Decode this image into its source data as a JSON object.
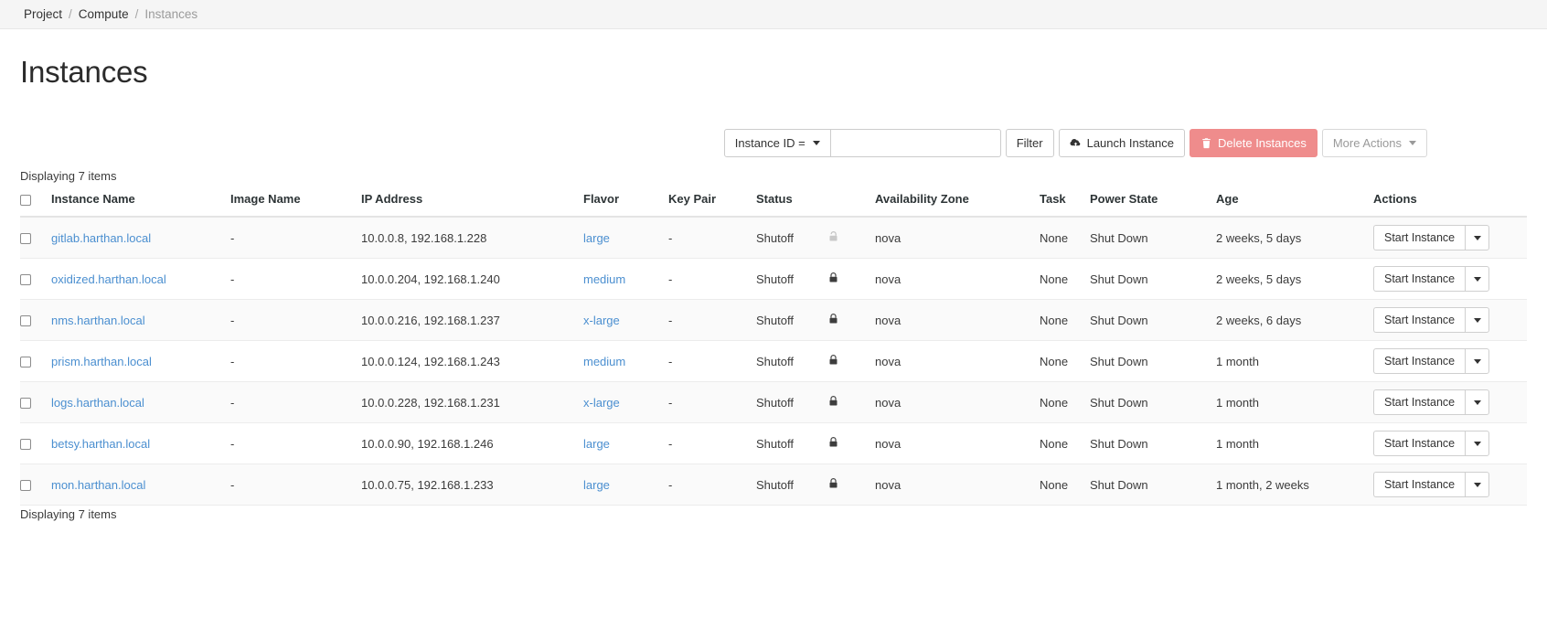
{
  "breadcrumb": {
    "items": [
      {
        "label": "Project",
        "link": true
      },
      {
        "label": "Compute",
        "link": true
      },
      {
        "label": "Instances",
        "link": false
      }
    ],
    "separator": "/"
  },
  "page": {
    "title": "Instances"
  },
  "toolbar": {
    "filter_field_label": "Instance ID =",
    "filter_field_icon": "chevron-down-icon",
    "search_value": "",
    "search_placeholder": "",
    "filter_button": "Filter",
    "launch_button": "Launch Instance",
    "launch_icon": "cloud-upload-icon",
    "delete_button": "Delete Instances",
    "delete_icon": "trash-icon",
    "delete_color": "#ef8c8c",
    "more_actions_button": "More Actions",
    "more_actions_icon": "chevron-down-icon"
  },
  "counts": {
    "top": "Displaying 7 items",
    "bottom": "Displaying 7 items"
  },
  "table": {
    "select_all_name": "select-all-checkbox",
    "headers": [
      "",
      "Instance Name",
      "Image Name",
      "IP Address",
      "Flavor",
      "Key Pair",
      "Status",
      "",
      "Availability Zone",
      "Task",
      "Power State",
      "Age",
      "Actions"
    ],
    "rows": [
      {
        "name": "gitlab.harthan.local",
        "image": "-",
        "ip": "10.0.0.8, 192.168.1.228",
        "flavor": "large",
        "keypair": "-",
        "status": "Shutoff",
        "lock": "unlock-icon",
        "lock_state": "unlocked",
        "availability_zone": "nova",
        "task": "None",
        "power_state": "Shut Down",
        "age": "2 weeks, 5 days",
        "action": "Start Instance"
      },
      {
        "name": "oxidized.harthan.local",
        "image": "-",
        "ip": "10.0.0.204, 192.168.1.240",
        "flavor": "medium",
        "keypair": "-",
        "status": "Shutoff",
        "lock": "lock-icon",
        "lock_state": "locked",
        "availability_zone": "nova",
        "task": "None",
        "power_state": "Shut Down",
        "age": "2 weeks, 5 days",
        "action": "Start Instance"
      },
      {
        "name": "nms.harthan.local",
        "image": "-",
        "ip": "10.0.0.216, 192.168.1.237",
        "flavor": "x-large",
        "keypair": "-",
        "status": "Shutoff",
        "lock": "lock-icon",
        "lock_state": "locked",
        "availability_zone": "nova",
        "task": "None",
        "power_state": "Shut Down",
        "age": "2 weeks, 6 days",
        "action": "Start Instance"
      },
      {
        "name": "prism.harthan.local",
        "image": "-",
        "ip": "10.0.0.124, 192.168.1.243",
        "flavor": "medium",
        "keypair": "-",
        "status": "Shutoff",
        "lock": "lock-icon",
        "lock_state": "locked",
        "availability_zone": "nova",
        "task": "None",
        "power_state": "Shut Down",
        "age": "1 month",
        "action": "Start Instance"
      },
      {
        "name": "logs.harthan.local",
        "image": "-",
        "ip": "10.0.0.228, 192.168.1.231",
        "flavor": "x-large",
        "keypair": "-",
        "status": "Shutoff",
        "lock": "lock-icon",
        "lock_state": "locked",
        "availability_zone": "nova",
        "task": "None",
        "power_state": "Shut Down",
        "age": "1 month",
        "action": "Start Instance"
      },
      {
        "name": "betsy.harthan.local",
        "image": "-",
        "ip": "10.0.0.90, 192.168.1.246",
        "flavor": "large",
        "keypair": "-",
        "status": "Shutoff",
        "lock": "lock-icon",
        "lock_state": "locked",
        "availability_zone": "nova",
        "task": "None",
        "power_state": "Shut Down",
        "age": "1 month",
        "action": "Start Instance"
      },
      {
        "name": "mon.harthan.local",
        "image": "-",
        "ip": "10.0.0.75, 192.168.1.233",
        "flavor": "large",
        "keypair": "-",
        "status": "Shutoff",
        "lock": "lock-icon",
        "lock_state": "locked",
        "availability_zone": "nova",
        "task": "None",
        "power_state": "Shut Down",
        "age": "1 month, 2 weeks",
        "action": "Start Instance"
      }
    ],
    "row_action_caret_icon": "chevron-down-icon"
  },
  "colors": {
    "link": "#4b8fd0",
    "danger": "#ef8c8c",
    "breadcrumb_bg": "#f5f5f5",
    "row_alt_bg": "#fafafa"
  }
}
